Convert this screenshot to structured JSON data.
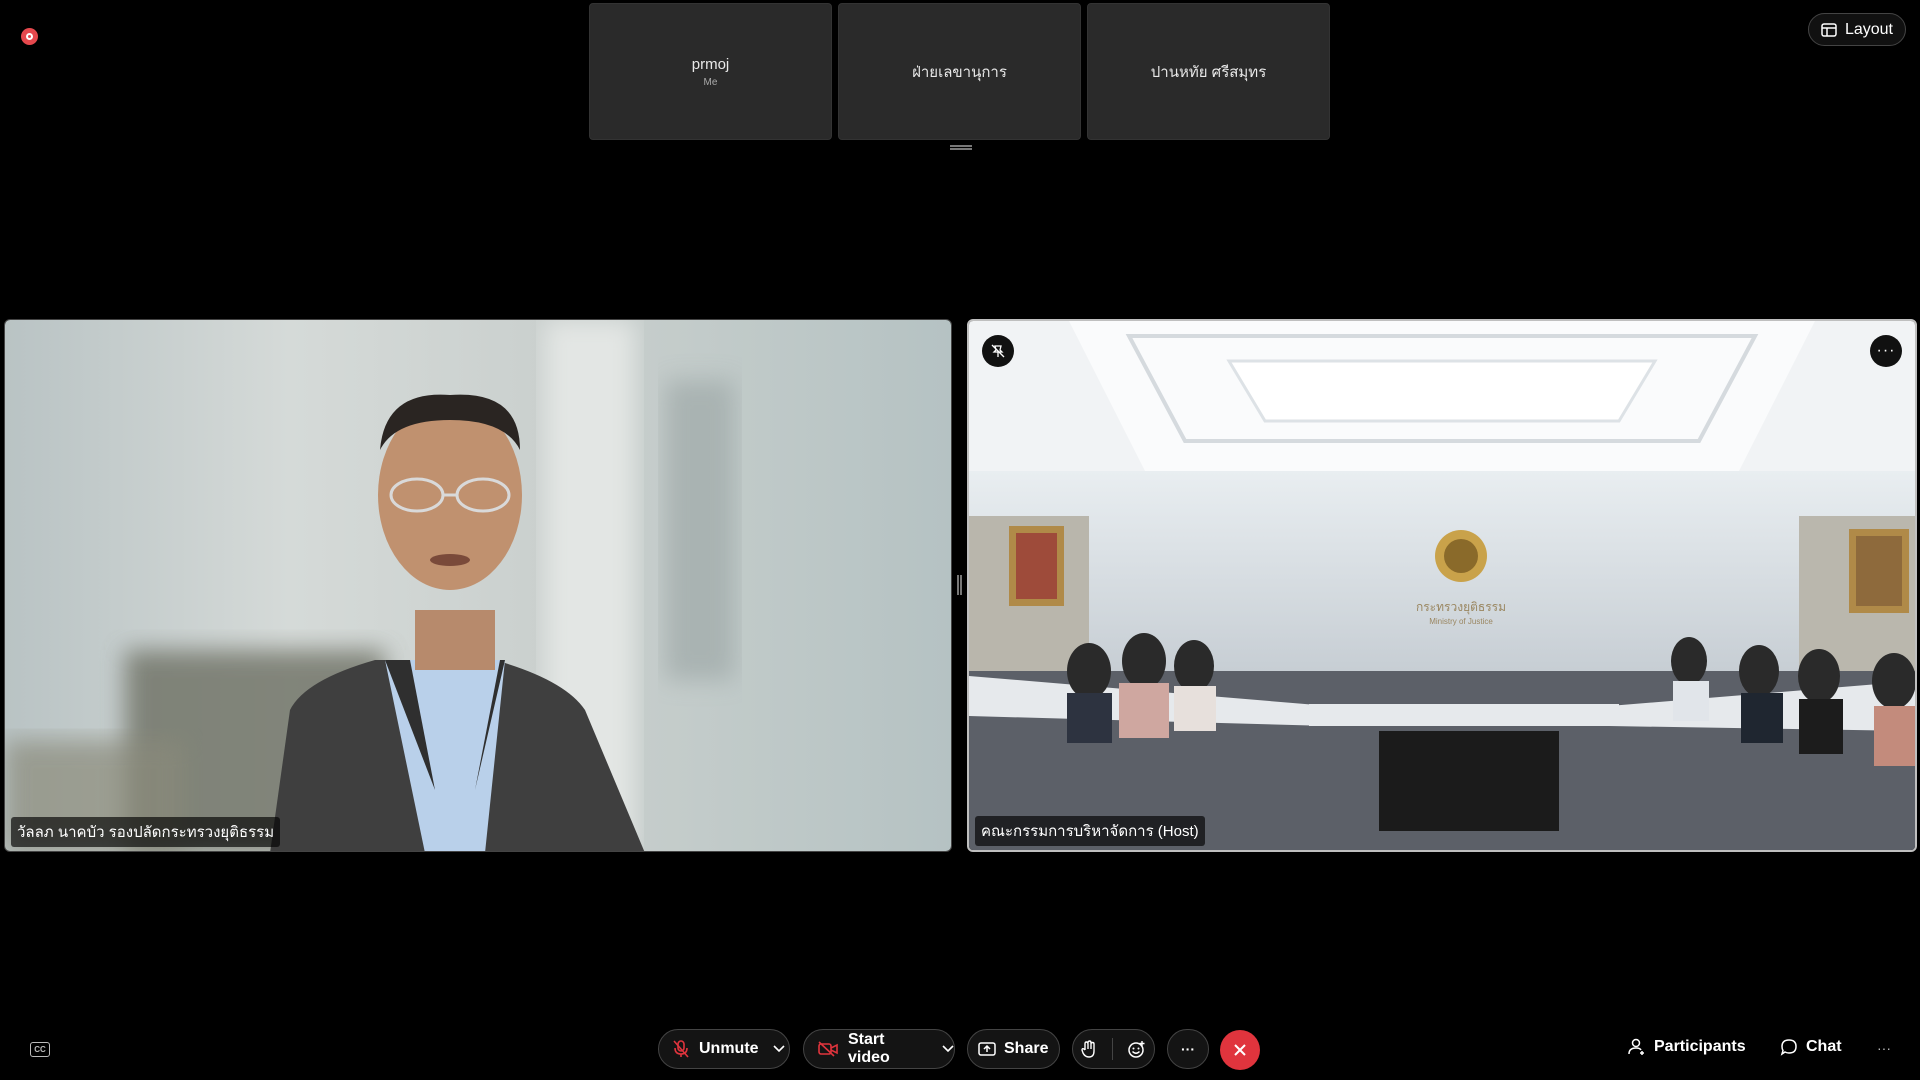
{
  "top": {
    "layout_label": "Layout"
  },
  "participants_strip": [
    {
      "name": "prmoj",
      "sub": "Me"
    },
    {
      "name": "ฝ่ายเลขานุการ",
      "sub": ""
    },
    {
      "name": "ปานหทัย ศรีสมุทร",
      "sub": ""
    }
  ],
  "tiles": {
    "left_label": "วัลลภ นาคบัว รองปลัดกระทรวงยุติธรรม",
    "right_label": "คณะกรรมการบริหาจัดการ (Host)",
    "right_wall_sign_1": "กระทรวงยุติธรรม",
    "right_wall_sign_2": "Ministry of Justice"
  },
  "toolbar": {
    "unmute": "Unmute",
    "start_video": "Start video",
    "share": "Share",
    "more": "···",
    "participants": "Participants",
    "chat": "Chat"
  },
  "colors": {
    "end_call": "#e0343d",
    "record": "#e5484d"
  }
}
